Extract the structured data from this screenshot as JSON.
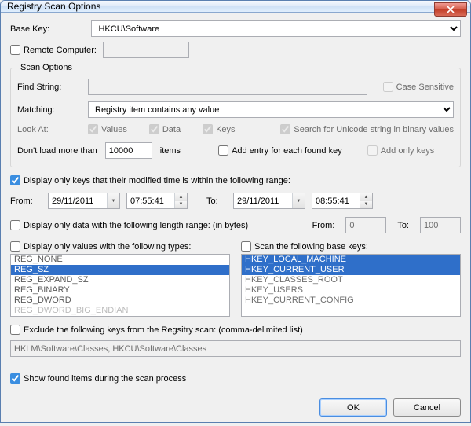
{
  "window": {
    "title": "Registry Scan Options"
  },
  "baseKey": {
    "label": "Base Key:",
    "value": "HKCU\\Software"
  },
  "remoteComputer": {
    "label": "Remote Computer:",
    "checked": false,
    "value": ""
  },
  "scanOptions": {
    "legend": "Scan Options",
    "findString": {
      "label": "Find String:",
      "value": ""
    },
    "caseSensitive": {
      "label": "Case Sensitive",
      "checked": false
    },
    "matching": {
      "label": "Matching:",
      "value": "Registry item contains any value"
    },
    "lookAt": {
      "label": "Look At:",
      "values": {
        "label": "Values",
        "checked": true
      },
      "data": {
        "label": "Data",
        "checked": true
      },
      "keys": {
        "label": "Keys",
        "checked": true
      },
      "searchUnicode": {
        "label": "Search for Unicode string in binary values",
        "checked": true
      }
    },
    "dontLoad": {
      "label": "Don't load more than",
      "value": "10000",
      "suffix": "items"
    },
    "addEntry": {
      "label": "Add entry for each found key",
      "checked": false
    },
    "addOnlyKeys": {
      "label": "Add only keys",
      "checked": false
    }
  },
  "modifiedRange": {
    "enable": {
      "label": "Display only keys that their modified time is within the following range:",
      "checked": true
    },
    "fromLabel": "From:",
    "toLabel": "To:",
    "fromDate": "29/11/2011",
    "fromTime": "07:55:41",
    "toDate": "29/11/2011",
    "toTime": "08:55:41"
  },
  "lengthRange": {
    "enable": {
      "label": "Display only data with the following length range: (in bytes)",
      "checked": false
    },
    "fromLabel": "From:",
    "from": "0",
    "toLabel": "To:",
    "to": "100"
  },
  "valueTypes": {
    "enable": {
      "label": "Display only values with the following types:",
      "checked": false
    },
    "items": [
      "REG_NONE",
      "REG_SZ",
      "REG_EXPAND_SZ",
      "REG_BINARY",
      "REG_DWORD",
      "REG_DWORD_BIG_ENDIAN"
    ],
    "selectedIndex": 1
  },
  "baseKeys": {
    "enable": {
      "label": "Scan the following base keys:",
      "checked": false
    },
    "items": [
      "HKEY_LOCAL_MACHINE",
      "HKEY_CURRENT_USER",
      "HKEY_CLASSES_ROOT",
      "HKEY_USERS",
      "HKEY_CURRENT_CONFIG"
    ],
    "selectedIndices": [
      0,
      1
    ]
  },
  "exclude": {
    "enable": {
      "label": "Exclude the following keys from the Regsitry scan: (comma-delimited list)",
      "checked": false
    },
    "value": "HKLM\\Software\\Classes, HKCU\\Software\\Classes"
  },
  "showFound": {
    "label": "Show found items during the scan process",
    "checked": true
  },
  "buttons": {
    "ok": "OK",
    "cancel": "Cancel"
  }
}
